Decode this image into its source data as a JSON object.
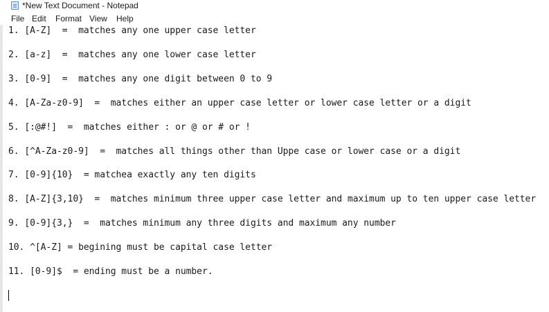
{
  "window": {
    "title": "*New Text Document - Notepad"
  },
  "menu": {
    "file": "File",
    "edit": "Edit",
    "format": "Format",
    "view": "View",
    "help": "Help"
  },
  "icons": {
    "app": "notepad-icon"
  },
  "document": {
    "lines": [
      "1. [A-Z]  =  matches any one upper case letter",
      "2. [a-z]  =  matches any one lower case letter",
      "3. [0-9]  =  matches any one digit between 0 to 9",
      "4. [A-Za-z0-9]  =  matches either an upper case letter or lower case letter or a digit",
      "5. [:@#!]  =  matches either : or @ or # or !",
      "6. [^A-Za-z0-9]  =  matches all things other than Uppe case or lower case or a digit",
      "7. [0-9]{10}  = matchea exactly any ten digits",
      "8. [A-Z]{3,10}  =  matches minimum three upper case letter and maximum up to ten upper case letter",
      "9. [0-9]{3,}  =  matches minimum any three digits and maximum any number",
      "10. ^[A-Z] = begining must be capital case letter",
      "11. [0-9]$  = ending must be a number."
    ]
  }
}
